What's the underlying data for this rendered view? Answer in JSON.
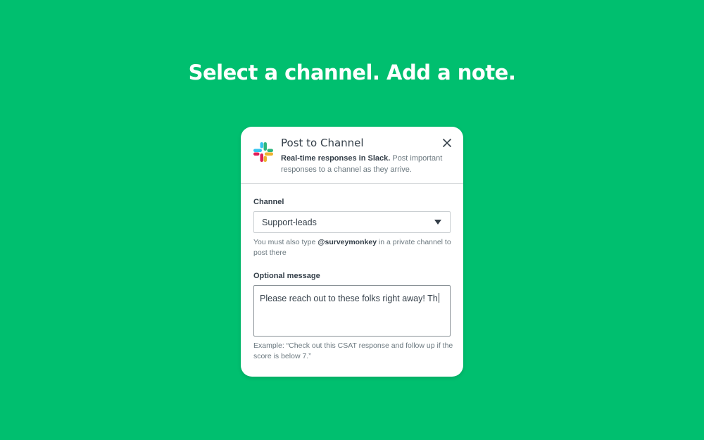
{
  "headline": "Select a channel. Add a note.",
  "dialog": {
    "title": "Post to Channel",
    "description_bold": "Real-time responses in Slack.",
    "description_rest": " Post important responses to a channel as they arrive.",
    "close_icon": "close-icon",
    "logo_icon": "slack-logo-icon"
  },
  "channel": {
    "label": "Channel",
    "selected": "Support-leads",
    "hint_prefix": "You must also type ",
    "hint_bold": "@surveymonkey",
    "hint_suffix": " in a private channel to post there"
  },
  "message": {
    "label": "Optional message",
    "value": "Please reach out to these folks right away! Th",
    "example": "Example: “Check out this CSAT response and follow up if the score is below 7.”"
  },
  "colors": {
    "background": "#00bf6f",
    "text_dark": "#333e48",
    "text_muted": "#6b787f"
  }
}
